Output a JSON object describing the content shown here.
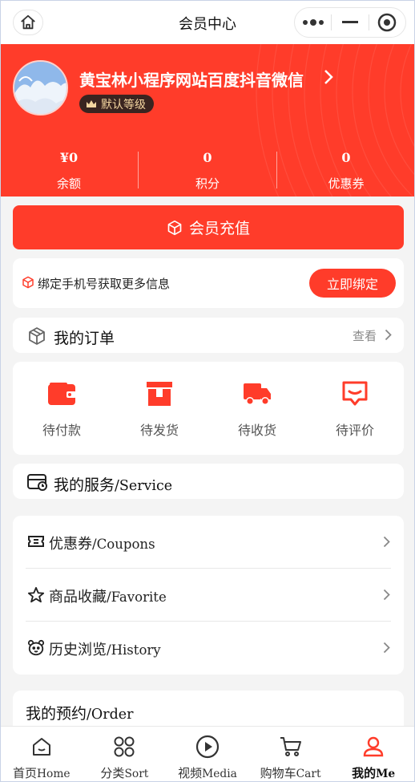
{
  "nav": {
    "title": "会员中心"
  },
  "profile": {
    "name": "黄宝林小程序网站百度抖音微信",
    "level": "默认等级"
  },
  "stats": [
    {
      "value": "¥0",
      "label": "余额"
    },
    {
      "value": "0",
      "label": "积分"
    },
    {
      "value": "0",
      "label": "优惠券"
    }
  ],
  "recharge": {
    "label": "会员充值"
  },
  "bind": {
    "text": "绑定手机号获取更多信息",
    "button": "立即绑定"
  },
  "orders": {
    "title": "我的订单",
    "view": "查看",
    "items": [
      {
        "label": "待付款",
        "icon": "wallet-icon"
      },
      {
        "label": "待发货",
        "icon": "box-icon"
      },
      {
        "label": "待收货",
        "icon": "truck-icon"
      },
      {
        "label": "待评价",
        "icon": "comment-icon"
      }
    ]
  },
  "service": {
    "title_cn": "我的服务",
    "title_en": "/Service"
  },
  "menu": [
    {
      "cn": "优惠券",
      "en": "/Coupons",
      "icon": "ticket-icon"
    },
    {
      "cn": "商品收藏",
      "en": "/Favorite",
      "icon": "star-icon"
    },
    {
      "cn": "历史浏览",
      "en": "/History",
      "icon": "bear-icon"
    }
  ],
  "reserve": {
    "cn": "我的预约",
    "en": "/Order"
  },
  "tabs": [
    {
      "cn": "首页",
      "en": "Home",
      "icon": "home-icon"
    },
    {
      "cn": "分类",
      "en": "Sort",
      "icon": "grid-icon"
    },
    {
      "cn": "视频",
      "en": "Media",
      "icon": "play-icon"
    },
    {
      "cn": "购物车",
      "en": "Cart",
      "icon": "cart-icon"
    },
    {
      "cn": "我的",
      "en": "Me",
      "icon": "user-icon",
      "active": true
    }
  ],
  "colors": {
    "accent": "#ff3c2a",
    "badge_bg": "#3a2420",
    "badge_text": "#f4d6a0"
  }
}
